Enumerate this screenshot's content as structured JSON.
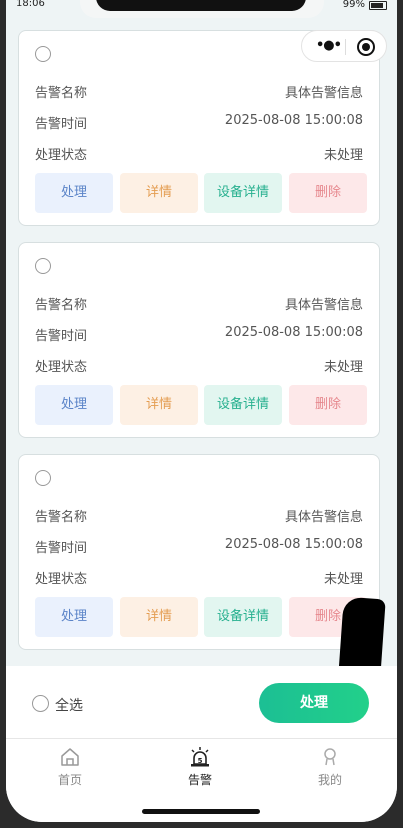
{
  "status": {
    "time": "18:06",
    "battery": "99%"
  },
  "cards": [
    {
      "rows": [
        {
          "label": "告警名称",
          "value": "具体告警信息"
        },
        {
          "label": "告警时间",
          "value": "2025-08-08 15:00:08"
        },
        {
          "label": "处理状态",
          "value": "未处理"
        }
      ],
      "buttons": {
        "process": "处理",
        "detail": "详情",
        "device": "设备详情",
        "delete": "删除"
      }
    },
    {
      "rows": [
        {
          "label": "告警名称",
          "value": "具体告警信息"
        },
        {
          "label": "告警时间",
          "value": "2025-08-08 15:00:08"
        },
        {
          "label": "处理状态",
          "value": "未处理"
        }
      ],
      "buttons": {
        "process": "处理",
        "detail": "详情",
        "device": "设备详情",
        "delete": "删除"
      }
    },
    {
      "rows": [
        {
          "label": "告警名称",
          "value": "具体告警信息"
        },
        {
          "label": "告警时间",
          "value": "2025-08-08 15:00:08"
        },
        {
          "label": "处理状态",
          "value": "未处理"
        }
      ],
      "buttons": {
        "process": "处理",
        "detail": "详情",
        "device": "设备详情",
        "delete": "删除"
      }
    }
  ],
  "bottom": {
    "select_all": "全选",
    "process_all": "处理"
  },
  "tabs": [
    {
      "label": "首页",
      "icon": "home-icon"
    },
    {
      "label": "告警",
      "icon": "alarm-icon"
    },
    {
      "label": "我的",
      "icon": "user-icon"
    }
  ],
  "colors": {
    "accent": "#1cbf94",
    "process": "#5b84c8",
    "detail": "#e49d52",
    "device": "#27b08f",
    "delete": "#e6878d"
  }
}
